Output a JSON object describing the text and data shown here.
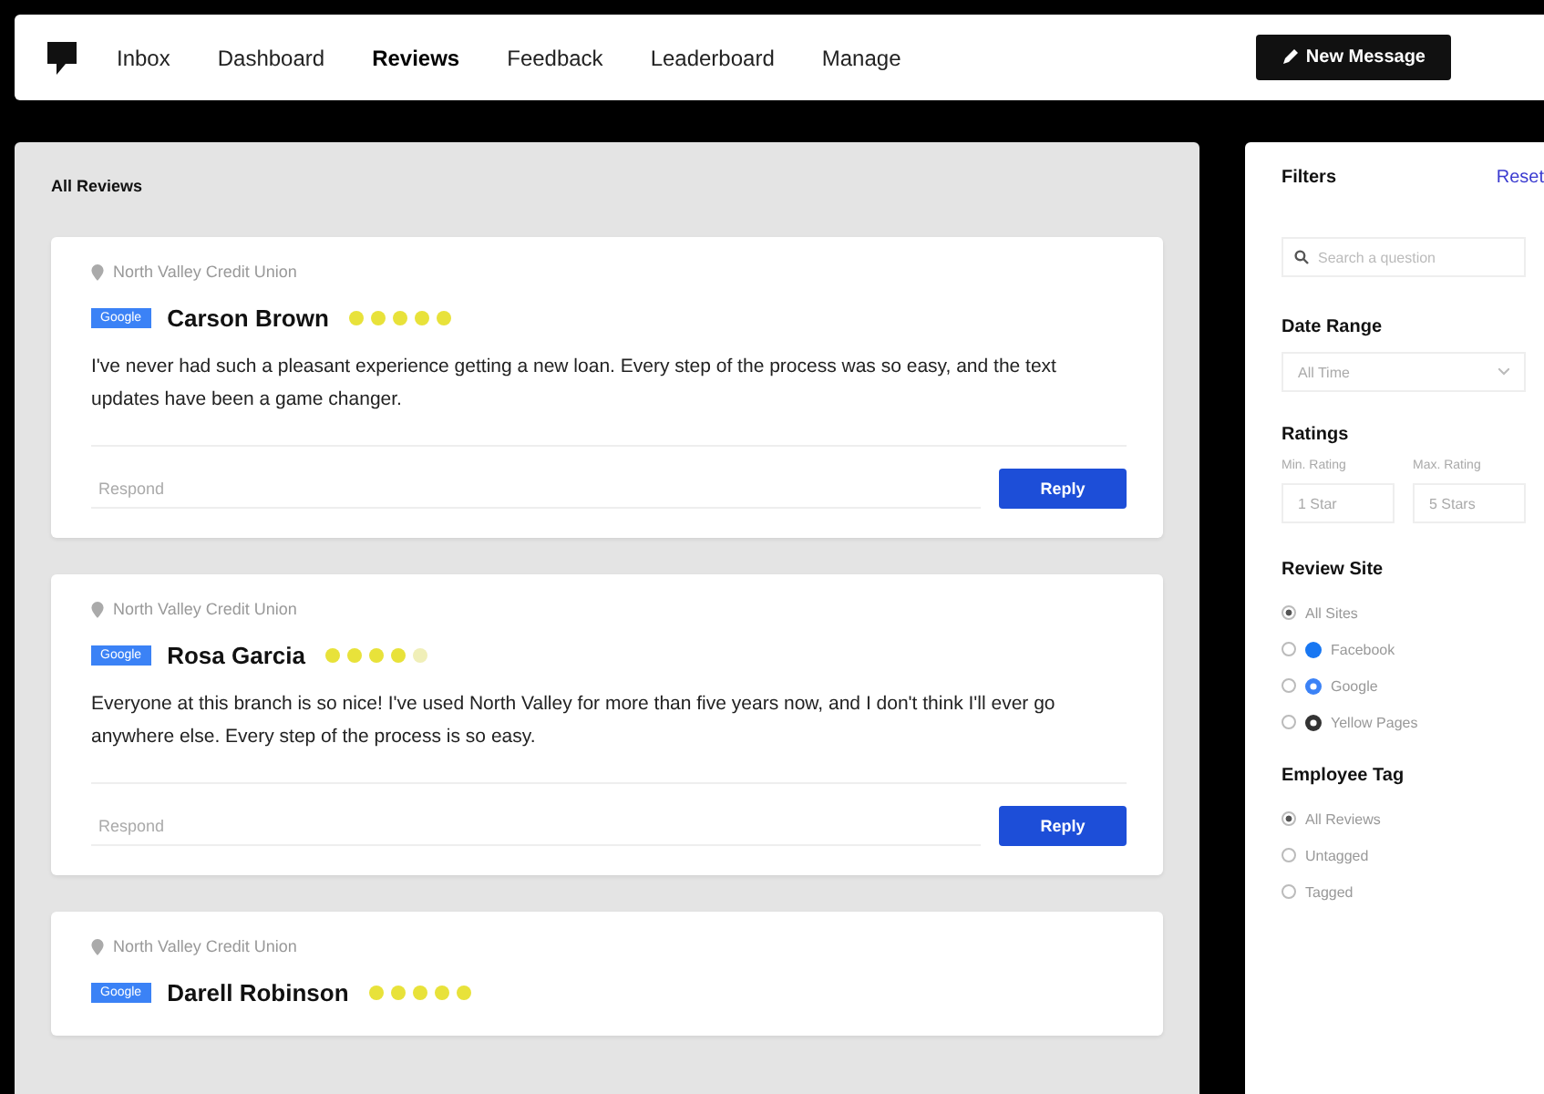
{
  "nav": {
    "items": [
      {
        "label": "Inbox",
        "selected": false
      },
      {
        "label": "Dashboard",
        "selected": false
      },
      {
        "label": "Reviews",
        "selected": true
      },
      {
        "label": "Feedback",
        "selected": false
      },
      {
        "label": "Leaderboard",
        "selected": false
      },
      {
        "label": "Manage",
        "selected": false
      }
    ],
    "new_message": "New Message"
  },
  "tabs": [
    {
      "label": "All Reviews",
      "selected": true
    }
  ],
  "reviews": [
    {
      "location": "North Valley Credit Union",
      "site": "Google",
      "name": "Carson Brown",
      "stars": 5,
      "text": "I've never had such a pleasant experience getting a new loan. Every step of the process was so easy, and the text updates have been a game changer.",
      "placeholder": "Respond",
      "reply": "Reply"
    },
    {
      "location": "North Valley Credit Union",
      "site": "Google",
      "name": "Rosa Garcia",
      "stars": 4,
      "text": "Everyone at this branch is so nice! I've used North Valley for more than five years now, and I don't think I'll ever go anywhere else. Every step of the process is so easy.",
      "placeholder": "Respond",
      "reply": "Reply"
    },
    {
      "location": "North Valley Credit Union",
      "site": "Google",
      "name": "Darell Robinson",
      "stars": 5
    }
  ],
  "filters": {
    "title": "Filters",
    "reset": "Reset",
    "search_placeholder": "Search a question",
    "date_range": {
      "label": "Date Range",
      "value": "All Time"
    },
    "ratings": {
      "label": "Ratings",
      "min_label": "Min. Rating",
      "max_label": "Max. Rating",
      "min_value": "1 Star",
      "max_value": "5 Stars"
    },
    "review_site": {
      "label": "Review Site",
      "options": [
        {
          "label": "All Sites",
          "selected": true,
          "kind": "none"
        },
        {
          "label": "Facebook",
          "selected": false,
          "kind": "facebook"
        },
        {
          "label": "Google",
          "selected": false,
          "kind": "google"
        },
        {
          "label": "Yellow Pages",
          "selected": false,
          "kind": "yellow"
        }
      ]
    },
    "employee_tag": {
      "label": "Employee Tag",
      "options": [
        {
          "label": "All Reviews",
          "selected": true
        },
        {
          "label": "Untagged",
          "selected": false
        },
        {
          "label": "Tagged",
          "selected": false
        }
      ]
    }
  }
}
